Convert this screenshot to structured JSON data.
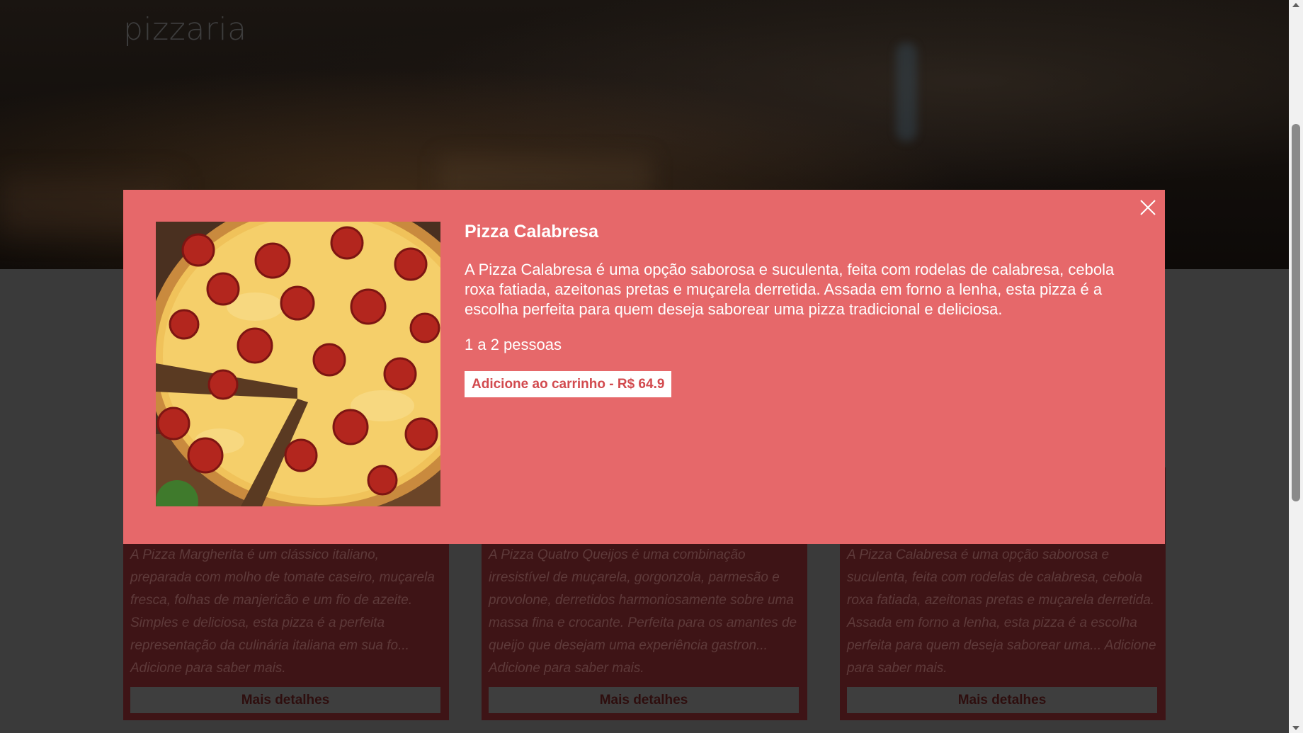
{
  "brand": "pizzaria",
  "cards": [
    {
      "description": "A Pizza Margherita é um clássico italiano, preparada com molho de tomate caseiro, muçarela fresca, folhas de manjericão e um fio de azeite. Simples e deliciosa, esta pizza é a perfeita representação da culinária italiana em sua fo... Adicione para saber mais.",
      "button": "Mais detalhes"
    },
    {
      "description": "A Pizza Quatro Queijos é uma combinação irresistível de muçarela, gorgonzola, parmesão e provolone, derretidos harmoniosamente sobre uma massa fina e crocante. Perfeita para os amantes de queijo que desejam uma experiência gastron... Adicione para saber mais.",
      "button": "Mais detalhes"
    },
    {
      "description": "A Pizza Calabresa é uma opção saborosa e suculenta, feita com rodelas de calabresa, cebola roxa fatiada, azeitonas pretas e muçarela derretida. Assada em forno a lenha, esta pizza é a escolha perfeita para quem deseja saborear uma... Adicione para saber mais.",
      "button": "Mais detalhes"
    }
  ],
  "modal": {
    "title": "Pizza Calabresa",
    "description": "A Pizza Calabresa é uma opção saborosa e suculenta, feita com rodelas de calabresa, cebola roxa fatiada, azeitonas pretas e muçarela derretida. Assada em forno a lenha, esta pizza é a escolha perfeita para quem deseja saborear uma pizza tradicional e deliciosa.",
    "serves": "1 a 2 pessoas",
    "add_button": "Adicione ao carrinho - R$ 64.9",
    "image_icon": "pizza-pepperoni-photo",
    "close_icon": "close-icon"
  },
  "colors": {
    "modal_bg": "#e6686a",
    "card_bg": "#3e1416",
    "accent_text": "#d24a4e"
  }
}
